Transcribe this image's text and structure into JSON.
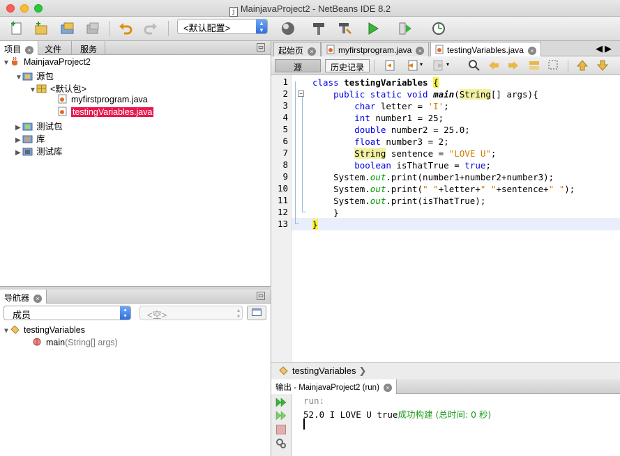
{
  "window": {
    "title": "MainjavaProject2 - NetBeans IDE 8.2",
    "file_icon": "j"
  },
  "toolbar": {
    "config_value": "<默认配置>",
    "icons": [
      "new-file-icon",
      "new-project-icon",
      "open-project-icon",
      "close-project-icon",
      "undo-icon",
      "redo-icon",
      "globe-icon",
      "build-icon",
      "clean-build-icon",
      "run-icon",
      "debug-icon",
      "profile-icon"
    ]
  },
  "projects_panel": {
    "tabs": [
      "项目",
      "文件",
      "服务"
    ],
    "tree": {
      "project": "MainjavaProject2",
      "source_packages": "源包",
      "default_package": "<默认包>",
      "files": [
        "myfirstprogram.java",
        "testingVariables.java"
      ],
      "test_packages": "测试包",
      "libraries": "库",
      "test_libraries": "测试库"
    }
  },
  "navigator": {
    "title": "导航器",
    "members_select": "成员",
    "filter_select": "<空>",
    "class_name": "testingVariables",
    "method_name": "main",
    "method_params": "(String[] args)"
  },
  "editor": {
    "tabs": [
      "起始页",
      "myfirstprogram.java",
      "testingVariables.java"
    ],
    "source_button": "源",
    "history_button": "历史记录",
    "line_numbers": [
      "1",
      "2",
      "3",
      "4",
      "5",
      "6",
      "7",
      "8",
      "9",
      "10",
      "11",
      "12",
      "13"
    ],
    "code": {
      "l1_kw": "class",
      "l1_name": "testingVariables",
      "l1_brace": "{",
      "l2_kw": "public static void",
      "l2_name": "main",
      "l2_type": "String",
      "l2_rest": "[] args){",
      "l3_kw": "char",
      "l3_mid": " letter = ",
      "l3_str": "'I'",
      "l3_end": ";",
      "l4_kw": "int",
      "l4_rest": " number1 = 25;",
      "l5_kw": "double",
      "l5_rest": " number2 = 25.0;",
      "l6_kw": "float",
      "l6_rest": " number3 = 2;",
      "l7_type": "String",
      "l7_mid": " sentence = ",
      "l7_str": "\"LOVE U\"",
      "l7_end": ";",
      "l8_kw": "boolean",
      "l8_mid": " isThatTrue = ",
      "l8_val": "true",
      "l8_end": ";",
      "l9_a": "System.",
      "l9_out": "out",
      "l9_b": ".print(number1+number2+number3);",
      "l10_a": "System.",
      "l10_out": "out",
      "l10_b": ".print(",
      "l10_s1": "\" \"",
      "l10_c": "+letter+",
      "l10_s2": "\" \"",
      "l10_d": "+sentence+",
      "l10_s3": "\" \"",
      "l10_e": ");",
      "l11_a": "System.",
      "l11_out": "out",
      "l11_b": ".print(isThatTrue);",
      "l12": "}",
      "l13": "}"
    },
    "breadcrumb": "testingVariables"
  },
  "output": {
    "tab": "输出 - MainjavaProject2 (run)",
    "line1": "run:",
    "line2_text": "52.0 I LOVE U true",
    "line2_status": "成功构建 (总时间: 0 秒)"
  }
}
